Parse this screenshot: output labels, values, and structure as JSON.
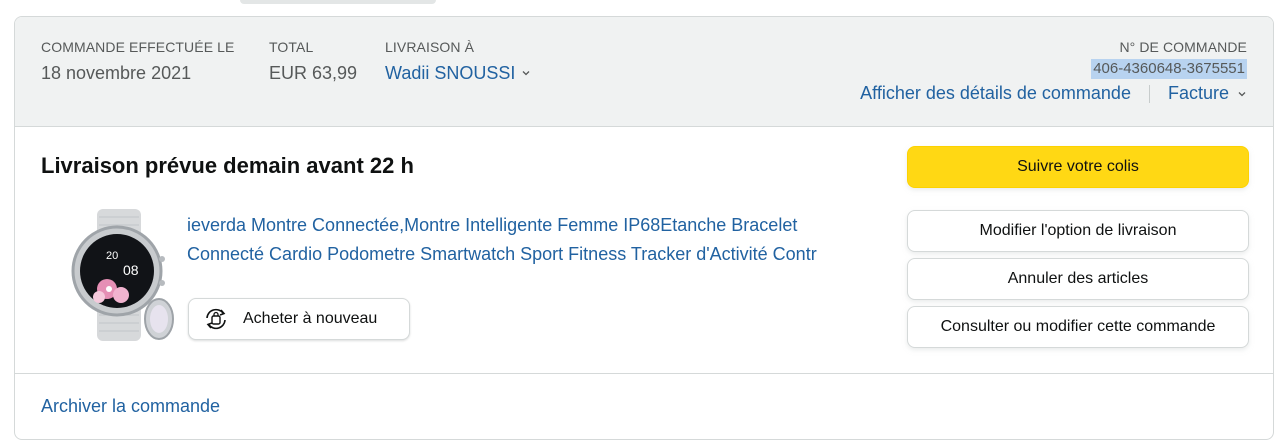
{
  "header": {
    "order_placed_label": "COMMANDE EFFECTUÉE LE",
    "order_placed_value": "18 novembre 2021",
    "total_label": "TOTAL",
    "total_value": "EUR 63,99",
    "ship_to_label": "LIVRAISON À",
    "ship_to_value": "Wadii SNOUSSI",
    "order_number_label": "N° DE COMMANDE",
    "order_number_value": "406-4360648-3675551",
    "order_details_link": "Afficher des détails de commande",
    "invoice_link": "Facture"
  },
  "shipment": {
    "delivery_status": "Livraison prévue demain avant 22 h",
    "product_title": "ieverda Montre Connectée,Montre Intelligente Femme IP68Etanche Bracelet Connecté Cardio Podometre Smartwatch Sport Fitness Tracker d'Activité Contr",
    "product_watch_hour": "20",
    "product_watch_minute": "08",
    "buy_again_label": "Acheter à nouveau"
  },
  "actions": {
    "track_package": "Suivre votre colis",
    "change_delivery": "Modifier l'option de livraison",
    "cancel_items": "Annuler des articles",
    "view_edit_order": "Consulter ou modifier cette commande"
  },
  "footer": {
    "archive_link": "Archiver la commande"
  },
  "icons": {
    "chevron": "chevron-down-icon",
    "buy_again": "buy-again-icon"
  },
  "colors": {
    "link": "#2162a1",
    "primary_button": "#ffd814",
    "header_bg": "#f0f2f2",
    "order_number_highlight": "#b8d3f0"
  }
}
